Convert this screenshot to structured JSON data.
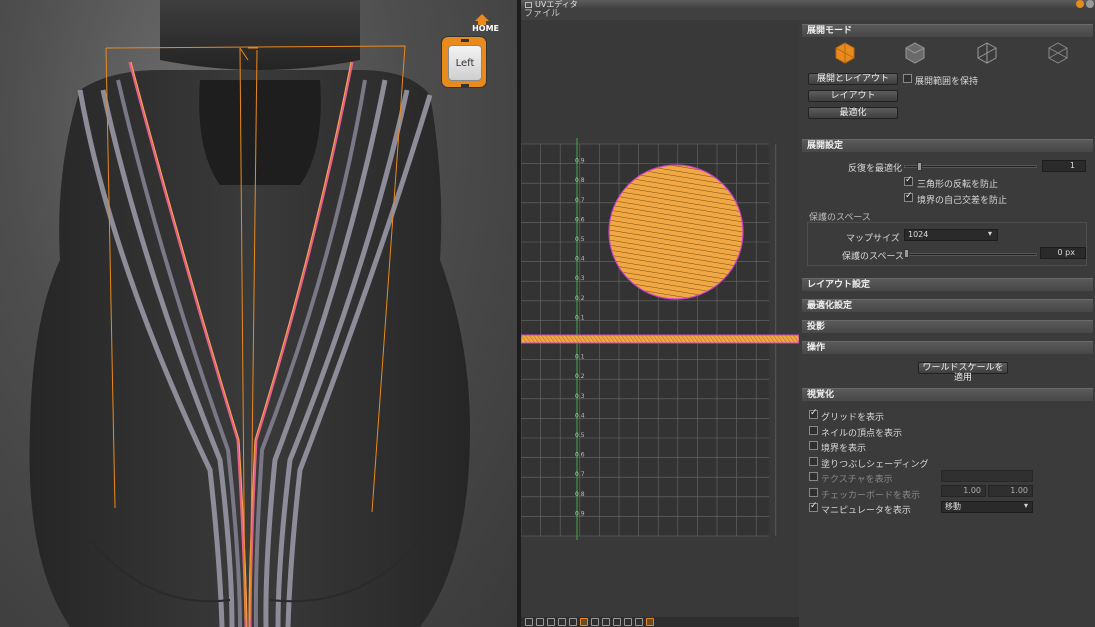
{
  "viewcube": {
    "home_label": "HOME",
    "face_label": "Left"
  },
  "window": {
    "title": "UVエディタ"
  },
  "menu": {
    "file": "ファイル"
  },
  "uv_grid": {
    "v_labels": [
      "0.9",
      "0.8",
      "0.7",
      "0.6",
      "0.5",
      "0.4",
      "0.3",
      "0.2",
      "0.1",
      "",
      "0.1",
      "0.2",
      "0.3",
      "0.4",
      "0.5",
      "0.6",
      "0.7",
      "0.8",
      "0.9"
    ]
  },
  "colors": {
    "accent": "#e98a1d",
    "uv_fill": "#f0a844",
    "uv_edge": "#d040d0",
    "axis": "#3fae3f"
  },
  "panel": {
    "mode_section": {
      "title": "展開モード",
      "mode_icons": [
        "unfold-mode-icon",
        "mode-2-icon",
        "mode-3-icon",
        "mode-4-icon"
      ],
      "btn_unfold_layout": "展開とレイアウト",
      "chk_keep_label": "展開範囲を保持",
      "btn_layout": "レイアウト",
      "btn_optimize": "最適化"
    },
    "unfold_settings": {
      "title": "展開設定",
      "opt_label": "反復を最適化",
      "opt_value": "1",
      "chk_tri_flip": "三角形の反転を防止",
      "chk_self_overlap": "境界の自己交差を防止",
      "group_label": "保護のスペース",
      "map_size_label": "マップサイズ",
      "map_size_value": "1024",
      "gutter_label": "保護のスペース",
      "gutter_value": "0 px"
    },
    "layout_settings": {
      "title": "レイアウト設定"
    },
    "optimize_settings": {
      "title": "最適化設定"
    },
    "projection": {
      "title": "投影"
    },
    "operations": {
      "title": "操作",
      "apply_button": "ワールドスケールを適用"
    },
    "display": {
      "title": "視覚化",
      "items": [
        {
          "label": "グリッドを表示",
          "checked": true
        },
        {
          "label": "ネイルの頂点を表示",
          "checked": false
        },
        {
          "label": "境界を表示",
          "checked": false
        },
        {
          "label": "塗りつぶしシェーディング",
          "checked": false
        },
        {
          "label": "テクスチャを表示",
          "checked": false
        },
        {
          "label": "チェッカーボードを表示",
          "checked": false
        },
        {
          "label": "マニピュレータを表示",
          "checked": true
        }
      ],
      "texture_value": "",
      "checker_u": "1.00",
      "checker_v": "1.00",
      "manip_value": "移動"
    }
  }
}
